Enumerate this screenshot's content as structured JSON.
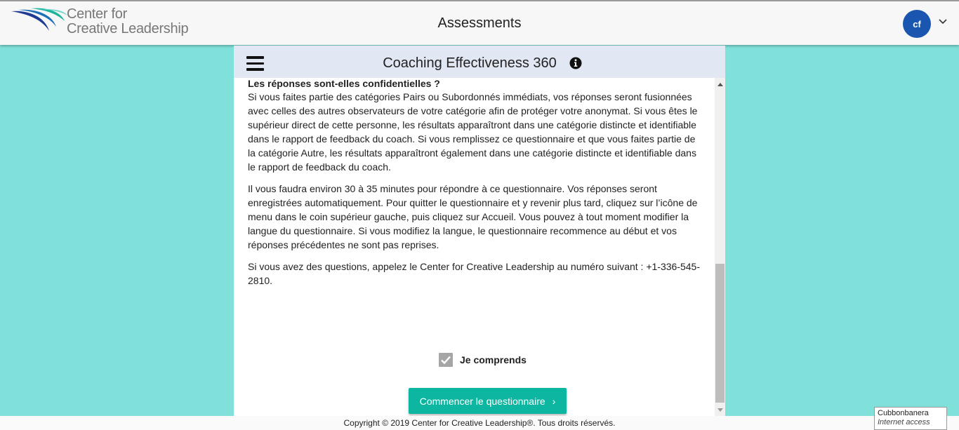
{
  "header": {
    "logo": {
      "line1": "Center for",
      "line2": "Creative Leadership"
    },
    "title": "Assessments",
    "avatar_initials": "cf",
    "menu_icon": "chevron-down-icon"
  },
  "panel": {
    "menu_icon": "hamburger-icon",
    "title": "Coaching Effectiveness 360",
    "info_icon": "info-icon",
    "heading": "Les réponses sont-elles confidentielles ?",
    "paragraphs": [
      "Si vous faites partie des catégories Pairs ou Subordonnés immédiats, vos réponses seront fusionnées avec celles des autres observateurs de votre catégorie afin de protéger votre anonymat. Si vous êtes le supérieur direct de cette personne, les résultats apparaîtront dans une catégorie distincte et identifiable dans le rapport de feedback du coach. Si vous remplissez ce questionnaire et que vous faites partie de la catégorie Autre, les résultats apparaîtront également dans une catégorie distincte et identifiable dans le rapport de feedback du coach.",
      "Il vous faudra environ 30 à 35 minutes pour répondre à ce questionnaire. Vos réponses seront enregistrées automatiquement. Pour quitter le questionnaire et y revenir plus tard, cliquez sur l’icône de menu dans le coin supérieur gauche, puis cliquez sur Accueil. Vous pouvez à tout moment modifier la langue du questionnaire. Si vous modifiez la langue, le questionnaire recommence au début et vos réponses précédentes ne sont pas reprises.",
      "Si vous avez des questions, appelez le Center for Creative Leadership au numéro suivant : +1-336-545-2810."
    ],
    "checkbox_label": "Je comprends",
    "checkbox_checked": true,
    "start_button": "Commencer le questionnaire",
    "start_arrow": "›"
  },
  "footer": {
    "copyright": "Copyright © 2019 Center for Creative Leadership®. Tous droits réservés."
  },
  "tooltip": {
    "title": "Cubbonbanera",
    "subtitle": "Internet access"
  },
  "colors": {
    "background": "#80e0da",
    "accent": "#0db6a0",
    "avatar": "#1a56b0",
    "panel_header": "#e1e7f3"
  }
}
